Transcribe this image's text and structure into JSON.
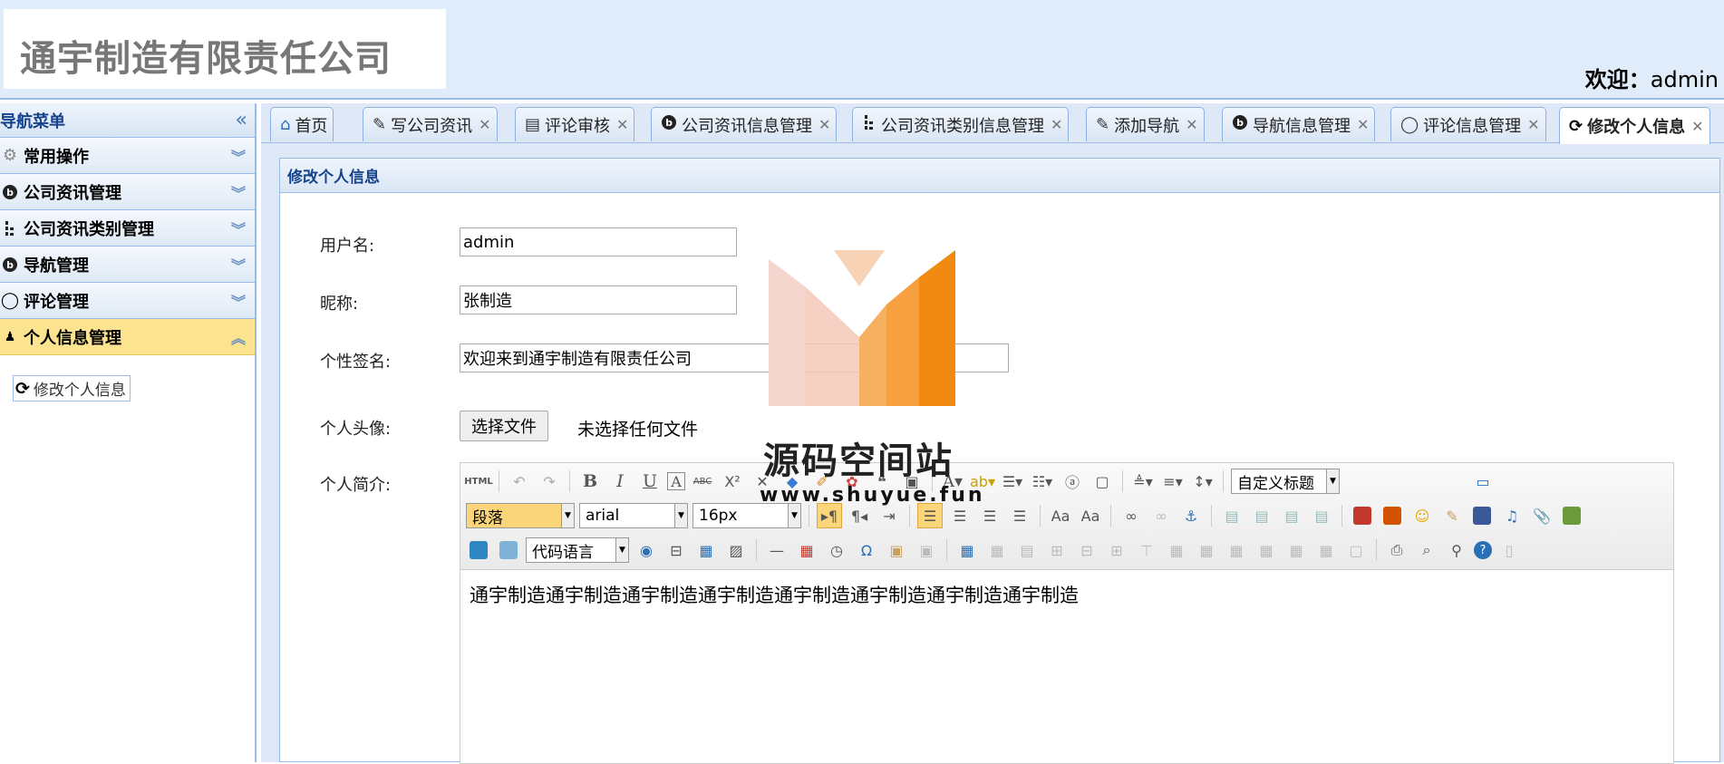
{
  "header": {
    "company": "通宇制造有限责任公司",
    "welcome_label": "欢迎：",
    "user": "admin"
  },
  "sidebar": {
    "title": "导航菜单",
    "collapse_icon": "double-chevron-left-icon",
    "items": [
      {
        "label": "常用操作",
        "icon": "gear-icon"
      },
      {
        "label": "公司资讯管理",
        "icon": "circle-b-icon"
      },
      {
        "label": "公司资讯类别管理",
        "icon": "tree-icon"
      },
      {
        "label": "导航管理",
        "icon": "circle-b-icon"
      },
      {
        "label": "评论管理",
        "icon": "comment-icon"
      },
      {
        "label": "个人信息管理",
        "icon": "person-icon",
        "active": true
      }
    ],
    "sub_items": [
      {
        "label": "修改个人信息",
        "icon": "refresh-icon"
      }
    ]
  },
  "tabs": [
    {
      "label": "首页",
      "icon": "home-icon",
      "closable": false
    },
    {
      "label": "写公司资讯",
      "icon": "edit-icon",
      "closable": true
    },
    {
      "label": "评论审核",
      "icon": "review-icon",
      "closable": true
    },
    {
      "label": "公司资讯信息管理",
      "icon": "circle-b-icon",
      "closable": true
    },
    {
      "label": "公司资讯类别信息管理",
      "icon": "tree-icon",
      "closable": true
    },
    {
      "label": "添加导航",
      "icon": "edit-icon",
      "closable": true
    },
    {
      "label": "导航信息管理",
      "icon": "circle-b-icon",
      "closable": true
    },
    {
      "label": "评论信息管理",
      "icon": "comment-icon",
      "closable": true
    },
    {
      "label": "修改个人信息",
      "icon": "refresh-icon",
      "closable": true,
      "active": true
    }
  ],
  "panel": {
    "title": "修改个人信息"
  },
  "form": {
    "username_label": "用户名:",
    "username_value": "admin",
    "nickname_label": "昵称:",
    "nickname_value": "张制造",
    "signature_label": "个性签名:",
    "signature_value": "欢迎来到通宇制造有限责任公司",
    "avatar_label": "个人头像:",
    "file_button": "选择文件",
    "file_status": "未选择任何文件",
    "bio_label": "个人简介:"
  },
  "editor": {
    "paragraph_select": "段落",
    "font_select": "arial",
    "size_select": "16px",
    "heading_select": "自定义标题",
    "code_select": "代码语言",
    "content": "通宇制造通宇制造通宇制造通宇制造通宇制造通宇制造通宇制造通宇制造"
  },
  "watermark": {
    "title": "源码空间站",
    "url": "www.shuyue.fun",
    "colors": [
      "#f4c9b8",
      "#f7a040",
      "#f08a10"
    ]
  }
}
